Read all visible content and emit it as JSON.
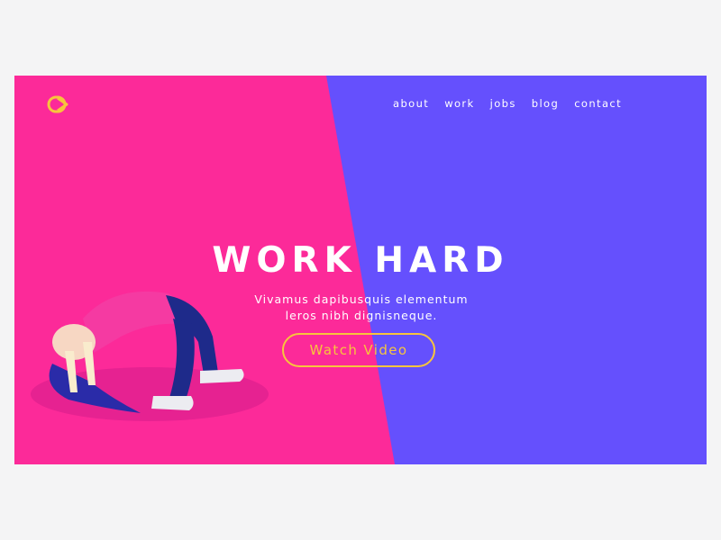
{
  "colors": {
    "pink": "#fc2a99",
    "purple": "#6550fd",
    "accent": "#f7c53d",
    "page_bg": "#f4f4f5"
  },
  "logo": {
    "icon": "brand-logo-icon"
  },
  "nav": {
    "items": [
      "about",
      "work",
      "jobs",
      "blog",
      "contact"
    ]
  },
  "hero": {
    "title": "WORK HARD",
    "subtitle_line1": "Vivamus dapibusquis elementum",
    "subtitle_line2": "leros nibh dignisneque.",
    "button_label": "Watch Video"
  },
  "illustration": {
    "icon": "bending-person-illustration"
  }
}
